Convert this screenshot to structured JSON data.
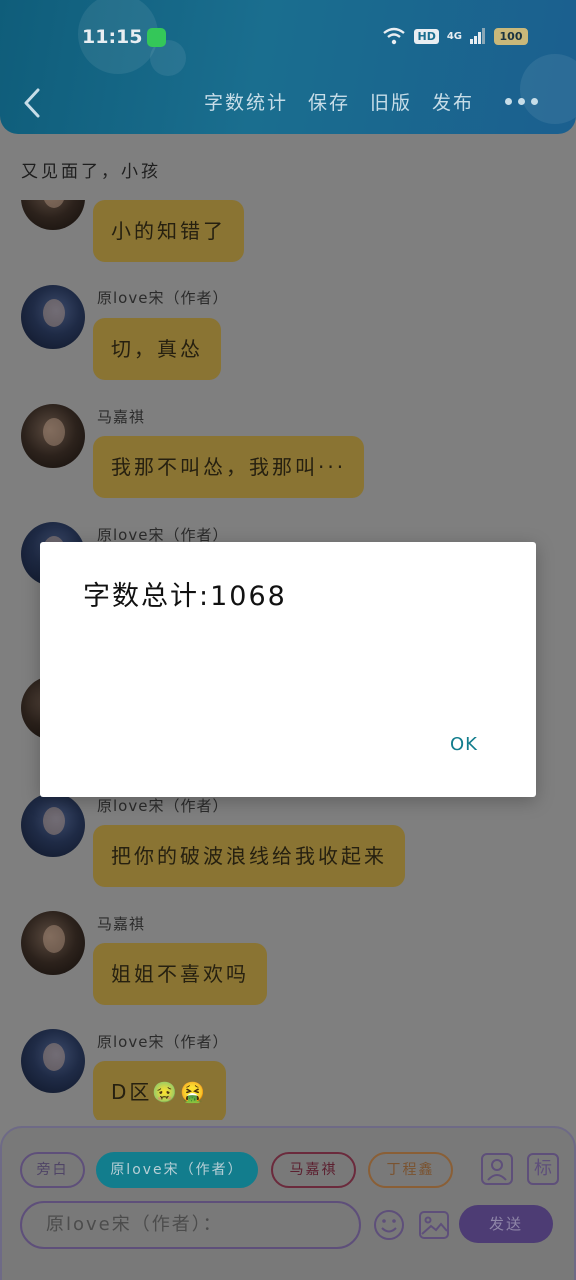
{
  "status_bar": {
    "time": "11:15",
    "hd": "HD",
    "network": "4G",
    "battery": "100"
  },
  "header": {
    "menu": [
      "字数统计",
      "保存",
      "旧版",
      "发布"
    ]
  },
  "chapter_title": "又见面了，小孩",
  "messages": [
    {
      "role": "ma",
      "sender": "",
      "text": "小的知错了"
    },
    {
      "role": "song",
      "sender": "原love宋（作者）",
      "text": "切，真怂"
    },
    {
      "role": "ma",
      "sender": "马嘉祺",
      "text": "我那不叫怂，我那叫···"
    },
    {
      "role": "song",
      "sender": "原love宋（作者）",
      "text": ""
    },
    {
      "role": "ma",
      "sender": "",
      "text": ""
    },
    {
      "role": "song",
      "sender": "原love宋（作者）",
      "text": "把你的破波浪线给我收起来"
    },
    {
      "role": "ma",
      "sender": "马嘉祺",
      "text": "姐姐不喜欢吗"
    },
    {
      "role": "song",
      "sender": "原love宋（作者）",
      "text": "D区🤢🤮"
    }
  ],
  "input_bar": {
    "roles": [
      "旁白",
      "原love宋（作者）",
      "马嘉祺",
      "丁程鑫"
    ],
    "placeholder": "原love宋（作者）：",
    "send_label": "发送",
    "avatar_tool": "头像",
    "mark_tool": "标"
  },
  "dialog": {
    "message": "字数总计:1068",
    "ok_label": "OK"
  },
  "colors": {
    "header": "#1a6e8f",
    "bubble": "#8a7433",
    "accent": "#127d8d",
    "send": "#4d3c74"
  }
}
